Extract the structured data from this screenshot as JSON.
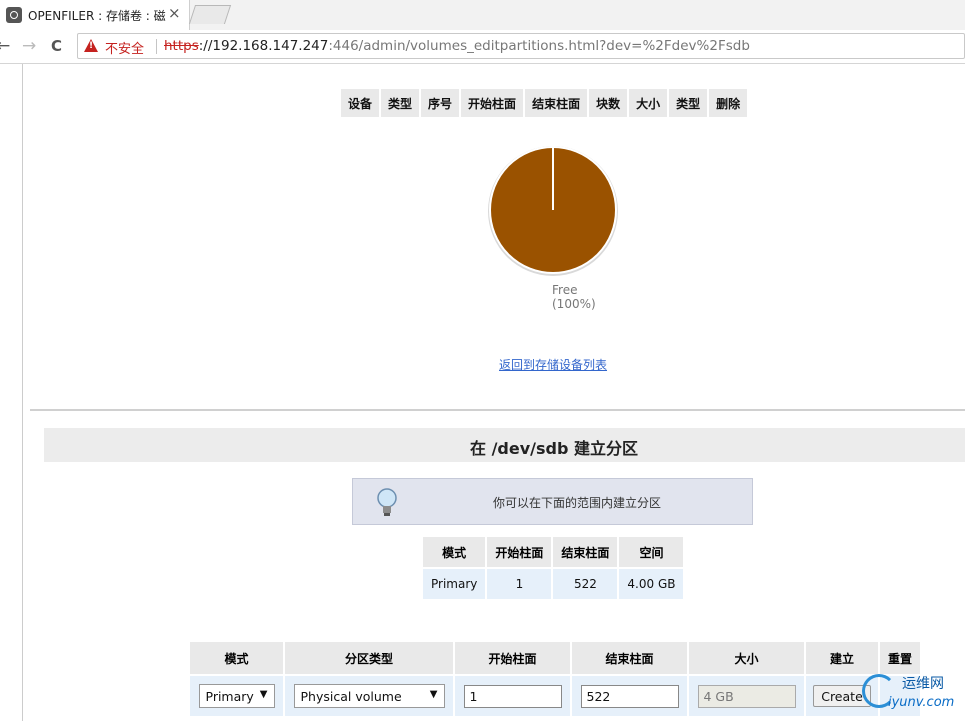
{
  "browser": {
    "tab_title": "OPENFILER : 存储卷 : 磁",
    "tab_close": "×",
    "back": "←",
    "forward": "→",
    "reload": "C",
    "security_label": "不安全",
    "url_proto": "https",
    "url_host": "://192.168.147.247",
    "url_rest": ":446/admin/volumes_editpartitions.html?dev=%2Fdev%2Fsdb"
  },
  "partitions_table": {
    "headers": [
      "设备",
      "类型",
      "序号",
      "开始柱面",
      "结束柱面",
      "块数",
      "大小",
      "类型",
      "删除"
    ]
  },
  "chart_data": {
    "type": "pie",
    "slices": [
      {
        "label": "Free",
        "percent": 100,
        "color": "#9a5200"
      }
    ],
    "label_line1": "Free",
    "label_line2": "(100%)"
  },
  "back_link": "返回到存储设备列表",
  "create_section": {
    "title": "在 /dev/sdb 建立分区",
    "info_text": "你可以在下面的范围内建立分区",
    "range_headers": [
      "模式",
      "开始柱面",
      "结束柱面",
      "空间"
    ],
    "range_row": [
      "Primary",
      "1",
      "522",
      "4.00 GB"
    ],
    "form_headers": [
      "模式",
      "分区类型",
      "开始柱面",
      "结束柱面",
      "大小",
      "建立",
      "重置"
    ],
    "mode_value": "Primary",
    "partition_type_value": "Physical volume",
    "start_cylinder": "1",
    "end_cylinder": "522",
    "size_value": "4 GB",
    "create_button": "Create"
  },
  "watermark": {
    "text1": "运维网",
    "text2": "iyunv.com"
  }
}
